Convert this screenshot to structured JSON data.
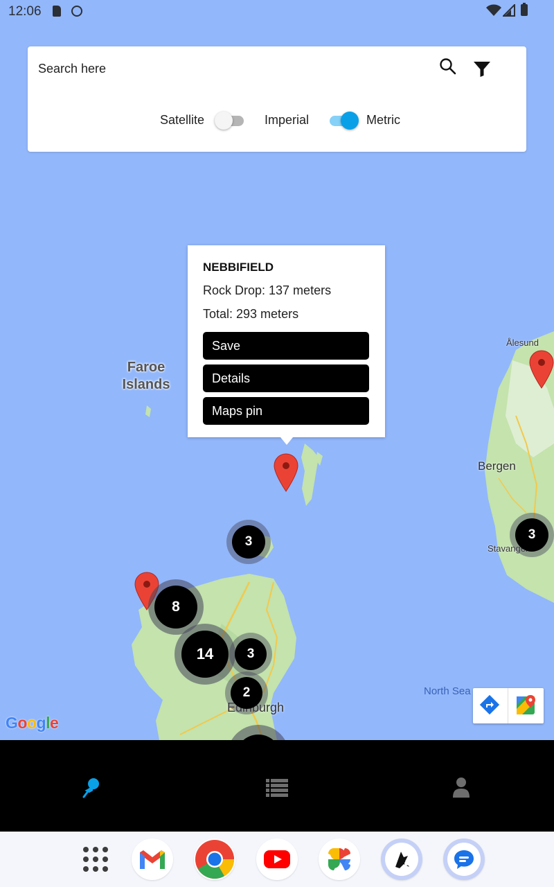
{
  "status_bar": {
    "time": "12:06"
  },
  "search": {
    "placeholder": "Search here"
  },
  "toggles": {
    "satellite_label": "Satellite",
    "satellite_on": false,
    "imperial_label": "Imperial",
    "metric_label": "Metric",
    "metric_on": true
  },
  "popup": {
    "title": "NEBBIFIELD",
    "rock_drop": "Rock Drop: 137 meters",
    "total": "Total: 293 meters",
    "save_label": "Save",
    "details_label": "Details",
    "maps_pin_label": "Maps pin"
  },
  "map_labels": {
    "faroe": "Faroe Islands",
    "alesund": "Ålesund",
    "bergen": "Bergen",
    "stavanger": "Stavanger",
    "north_sea": "North Sea",
    "edinburgh": "Edinburgh",
    "google": "Google"
  },
  "clusters": [
    {
      "count": "3"
    },
    {
      "count": "8"
    },
    {
      "count": "14"
    },
    {
      "count": "3"
    },
    {
      "count": "2"
    },
    {
      "count": "3"
    }
  ],
  "bottom_nav": {
    "items": [
      {
        "icon": "pin-icon",
        "active": true
      },
      {
        "icon": "list-icon",
        "active": false
      },
      {
        "icon": "person-icon",
        "active": false
      }
    ]
  },
  "dock": {
    "apps": [
      {
        "icon": "app-drawer-icon"
      },
      {
        "icon": "gmail-icon"
      },
      {
        "icon": "chrome-icon"
      },
      {
        "icon": "youtube-icon"
      },
      {
        "icon": "photos-icon"
      },
      {
        "icon": "climber-app-icon"
      },
      {
        "icon": "messages-icon"
      }
    ]
  },
  "colors": {
    "sea": "#92b7fb",
    "land": "#c4e3ad",
    "accent": "#0aa0e8",
    "pin": "#ea4335"
  }
}
